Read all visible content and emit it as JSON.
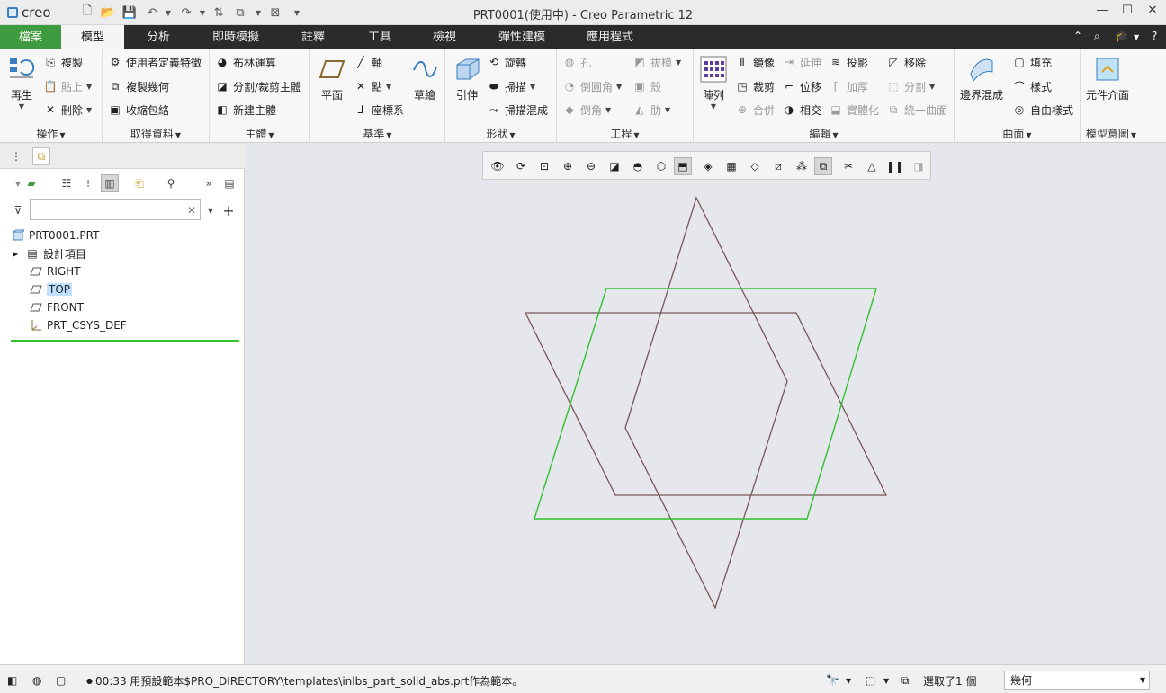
{
  "app": {
    "logo_text": "creo",
    "window_title": "PRT0001(使用中) - Creo Parametric 12"
  },
  "tabs": [
    {
      "label": "檔案"
    },
    {
      "label": "模型"
    },
    {
      "label": "分析"
    },
    {
      "label": "即時模擬"
    },
    {
      "label": "註釋"
    },
    {
      "label": "工具"
    },
    {
      "label": "檢視"
    },
    {
      "label": "彈性建模"
    },
    {
      "label": "應用程式"
    }
  ],
  "ribbon": {
    "operations": {
      "label": "操作",
      "regenerate": "再生",
      "copy": "複製",
      "paste": "貼上",
      "delete": "刪除"
    },
    "get_data": {
      "label": "取得資料",
      "udf": "使用者定義特徵",
      "copy_geom": "複製幾何",
      "shrinkwrap": "收縮包絡"
    },
    "body": {
      "label": "主體",
      "boolean": "布林運算",
      "split": "分割/裁剪主體",
      "new_body": "新建主體"
    },
    "datum": {
      "label": "基準",
      "plane": "平面",
      "axis": "軸",
      "point": "點",
      "csys": "座標系",
      "sketch": "草繪"
    },
    "shapes": {
      "label": "形狀",
      "extrude": "引伸",
      "revolve": "旋轉",
      "sweep": "掃描",
      "swept_blend": "掃描混成"
    },
    "engineering": {
      "label": "工程",
      "hole": "孔",
      "round": "倒圓角",
      "chamfer": "倒角",
      "draft": "拔模",
      "shell": "殼",
      "rib": "肋"
    },
    "editing": {
      "label": "編輯",
      "pattern": "陣列",
      "mirror": "鏡像",
      "trim": "裁剪",
      "merge": "合併",
      "extend": "延伸",
      "offset": "位移",
      "intersect": "相交",
      "project": "投影",
      "thicken": "加厚",
      "solidify": "實體化",
      "remove": "移除",
      "split": "分割",
      "unify": "統一曲面"
    },
    "surfaces": {
      "label": "曲面",
      "boundary_blend": "邊界混成",
      "fill": "填充",
      "style": "樣式",
      "freestyle": "自由樣式"
    },
    "model_intent": {
      "label": "模型意圖",
      "component_interface": "元件介面"
    }
  },
  "model_tree": {
    "filter_placeholder": "",
    "root": "PRT0001.PRT",
    "items": [
      {
        "label": "設計項目"
      },
      {
        "label": "RIGHT"
      },
      {
        "label": "TOP"
      },
      {
        "label": "FRONT"
      },
      {
        "label": "PRT_CSYS_DEF"
      }
    ]
  },
  "status": {
    "message": "00:33 用預設範本$PRO_DIRECTORY\\templates\\inlbs_part_solid_abs.prt作為範本。",
    "selection_count": "選取了1 個",
    "filter_value": "幾何"
  },
  "colors": {
    "accent": "#3f9b3f",
    "selected_plane": "#2ec22e",
    "plane": "#7a5557",
    "tabbar": "#2b2b2b"
  }
}
